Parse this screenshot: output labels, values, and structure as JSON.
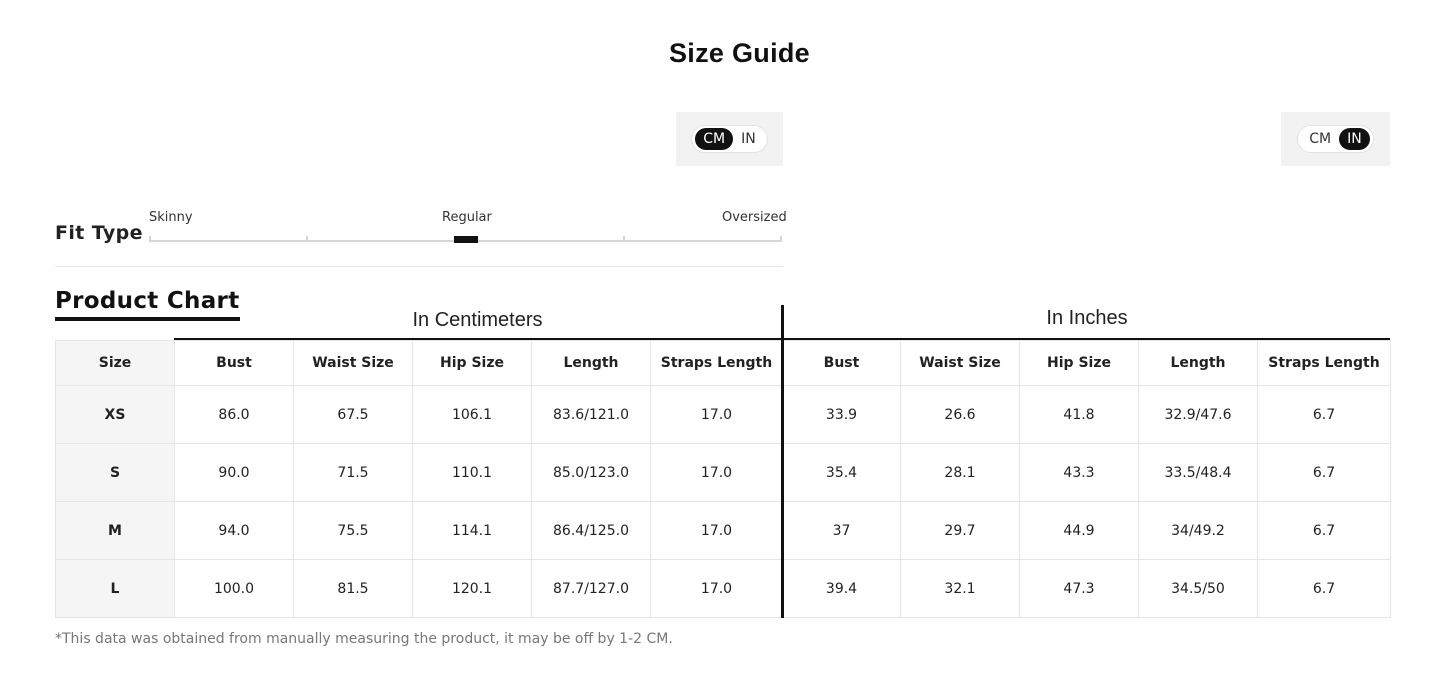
{
  "page_title": "Size Guide",
  "unit_toggle_left": {
    "options": [
      "CM",
      "IN"
    ],
    "active": "CM"
  },
  "unit_toggle_right": {
    "options": [
      "CM",
      "IN"
    ],
    "active": "IN"
  },
  "fit_type": {
    "label": "Fit Type",
    "scale_labels": [
      "Skinny",
      "Regular",
      "Oversized"
    ],
    "selected": "Regular"
  },
  "product_chart_label": "Product Chart",
  "unit_headings": {
    "cm": "In Centimeters",
    "inch": "In Inches"
  },
  "table": {
    "size_header": "Size",
    "cm_headers": [
      "Bust",
      "Waist Size",
      "Hip Size",
      "Length",
      "Straps Length"
    ],
    "in_headers": [
      "Bust",
      "Waist Size",
      "Hip Size",
      "Length",
      "Straps Length"
    ],
    "rows": [
      {
        "size": "XS",
        "cm": [
          "86.0",
          "67.5",
          "106.1",
          "83.6/121.0",
          "17.0"
        ],
        "in": [
          "33.9",
          "26.6",
          "41.8",
          "32.9/47.6",
          "6.7"
        ]
      },
      {
        "size": "S",
        "cm": [
          "90.0",
          "71.5",
          "110.1",
          "85.0/123.0",
          "17.0"
        ],
        "in": [
          "35.4",
          "28.1",
          "43.3",
          "33.5/48.4",
          "6.7"
        ]
      },
      {
        "size": "M",
        "cm": [
          "94.0",
          "75.5",
          "114.1",
          "86.4/125.0",
          "17.0"
        ],
        "in": [
          "37",
          "29.7",
          "44.9",
          "34/49.2",
          "6.7"
        ]
      },
      {
        "size": "L",
        "cm": [
          "100.0",
          "81.5",
          "120.1",
          "87.7/127.0",
          "17.0"
        ],
        "in": [
          "39.4",
          "32.1",
          "47.3",
          "34.5/50",
          "6.7"
        ]
      }
    ]
  },
  "footnote": "*This data was obtained from manually measuring the product, it may be off by 1-2 CM.",
  "colors": {
    "accent": "#111111",
    "panel_bg": "#f2f2f2",
    "size_col_bg": "#f5f5f5",
    "border": "#e5e5e5"
  }
}
